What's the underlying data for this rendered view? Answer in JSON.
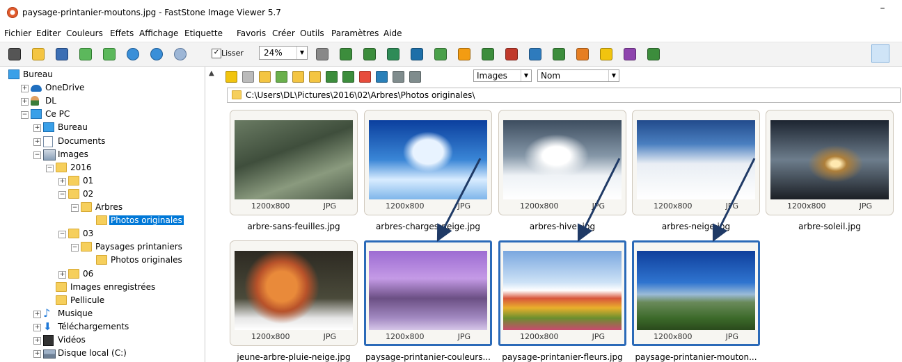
{
  "window": {
    "title": "paysage-printanier-moutons.jpg  -  FastStone Image Viewer 5.7",
    "minimize_glyph": "–"
  },
  "menu": [
    "Fichier",
    "Editer",
    "Couleurs",
    "Effets",
    "Affichage",
    "Etiquette",
    "Favoris",
    "Créer",
    "Outils",
    "Paramètres",
    "Aide"
  ],
  "toolbar": {
    "icons": [
      "camera-icon",
      "open-folder-icon",
      "save-icon",
      "prev-icon",
      "next-icon",
      "zoom-in-icon",
      "zoom-out-icon",
      "actual-size-icon"
    ],
    "smooth_label": "Lisser",
    "smooth_checked": "✓",
    "zoom_value": "24%",
    "right_icons": [
      "hand-icon",
      "crop-icon",
      "resize-icon",
      "adjust-icon",
      "text-icon",
      "person-icon",
      "sun-icon",
      "rotate-left-icon",
      "rotate-right-icon",
      "compare-icon",
      "slideshow-icon",
      "draw-icon",
      "email-icon",
      "print-icon",
      "batch-icon"
    ]
  },
  "tree": {
    "items": [
      {
        "label": "Bureau",
        "icon": "desktop-icon"
      },
      {
        "label": "OneDrive",
        "icon": "cloud-icon"
      },
      {
        "label": "DL",
        "icon": "user-icon"
      },
      {
        "label": "Ce PC",
        "icon": "computer-icon"
      },
      {
        "label": "Bureau",
        "icon": "desktop-icon"
      },
      {
        "label": "Documents",
        "icon": "document-icon"
      },
      {
        "label": "Images",
        "icon": "images-icon"
      },
      {
        "label": "2016",
        "icon": "folder-icon"
      },
      {
        "label": "01",
        "icon": "folder-icon"
      },
      {
        "label": "02",
        "icon": "folder-icon"
      },
      {
        "label": "Arbres",
        "icon": "folder-icon"
      },
      {
        "label": "Photos originales",
        "icon": "folder-icon"
      },
      {
        "label": "03",
        "icon": "folder-icon"
      },
      {
        "label": "Paysages printaniers",
        "icon": "folder-icon"
      },
      {
        "label": "Photos originales",
        "icon": "folder-icon"
      },
      {
        "label": "06",
        "icon": "folder-icon"
      },
      {
        "label": "Images enregistrées",
        "icon": "folder-icon"
      },
      {
        "label": "Pellicule",
        "icon": "folder-icon"
      },
      {
        "label": "Musique",
        "icon": "music-icon"
      },
      {
        "label": "Téléchargements",
        "icon": "download-icon"
      },
      {
        "label": "Vidéos",
        "icon": "video-icon"
      },
      {
        "label": "Disque local (C:)",
        "icon": "disk-icon"
      }
    ]
  },
  "browser": {
    "filter_value": "Images",
    "sort_value": "Nom",
    "path": "C:\\Users\\DL\\Pictures\\2016\\02\\Arbres\\Photos originales\\"
  },
  "thumbnails": [
    {
      "name": "arbre-sans-feuilles.jpg",
      "dims": "1200x800",
      "format": "JPG"
    },
    {
      "name": "arbres-charges-neige.jpg",
      "dims": "1200x800",
      "format": "JPG"
    },
    {
      "name": "arbres-hiver.jpg",
      "dims": "1200x800",
      "format": "JPG"
    },
    {
      "name": "arbres-neige.jpg",
      "dims": "1200x800",
      "format": "JPG"
    },
    {
      "name": "arbre-soleil.jpg",
      "dims": "1200x800",
      "format": "JPG"
    },
    {
      "name": "jeune-arbre-pluie-neige.jpg",
      "dims": "1200x800",
      "format": "JPG"
    },
    {
      "name": "paysage-printanier-couleurs...",
      "dims": "1200x800",
      "format": "JPG"
    },
    {
      "name": "paysage-printanier-fleurs.jpg",
      "dims": "1200x800",
      "format": "JPG"
    },
    {
      "name": "paysage-printanier-mouton...",
      "dims": "1200x800",
      "format": "JPG"
    }
  ],
  "colors": {
    "selection": "#0078d7",
    "thumb_selected_border": "#2b6ab8",
    "arrow": "#1f3a66"
  }
}
